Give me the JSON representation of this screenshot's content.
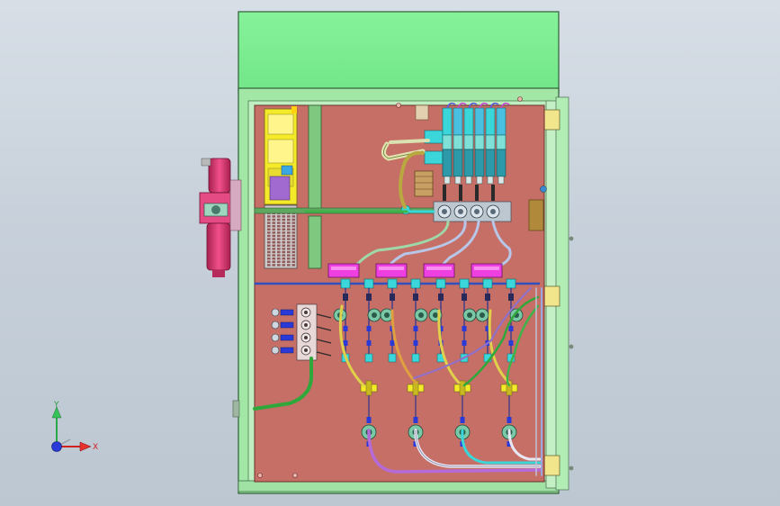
{
  "triad": {
    "x_label": "X",
    "y_label": "Y"
  },
  "colors": {
    "background": "#c9d2dc",
    "cabinet_green": "#98e8a0",
    "top_hood": "#7eef92",
    "backplate": "#c56f66",
    "magenta_blocks": "#ee3fe0",
    "yellow_relays": "#f4ea2a",
    "cyan_fittings": "#3ad6d9",
    "tube_green": "#3fb24a",
    "filter_magenta": "#e53a78"
  },
  "components": {
    "manifold_modules": 4,
    "valve_columns": 8,
    "lower_regulators": 4,
    "left_fittings": 4
  }
}
